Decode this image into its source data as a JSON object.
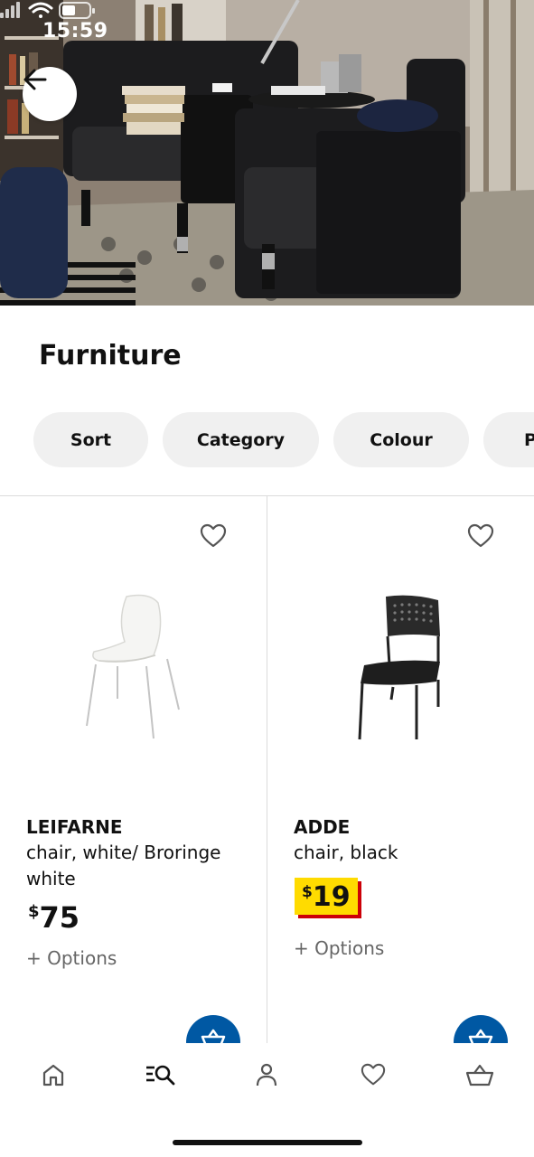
{
  "status_bar": {
    "time": "15:59"
  },
  "page": {
    "title": "Furniture"
  },
  "filters": [
    {
      "label": "Sort"
    },
    {
      "label": "Category"
    },
    {
      "label": "Colour"
    },
    {
      "label": "P"
    }
  ],
  "products": [
    {
      "name": "LEIFARNE",
      "description": "chair, white/ Broringe white",
      "price_currency": "$",
      "price_amount": "75",
      "price_style": "regular",
      "options": "+ Options"
    },
    {
      "name": "ADDE",
      "description": "chair, black",
      "price_currency": "$",
      "price_amount": "19",
      "price_style": "highlight",
      "options": "+ Options"
    }
  ],
  "nav": [
    {
      "icon": "home-icon"
    },
    {
      "icon": "search-list-icon",
      "active": true
    },
    {
      "icon": "profile-icon"
    },
    {
      "icon": "heart-icon"
    },
    {
      "icon": "basket-icon"
    }
  ],
  "colors": {
    "accent_blue": "#0058a3",
    "price_yellow": "#ffdb00",
    "price_red": "#cc0008",
    "chip_bg": "#f0f0f0"
  }
}
